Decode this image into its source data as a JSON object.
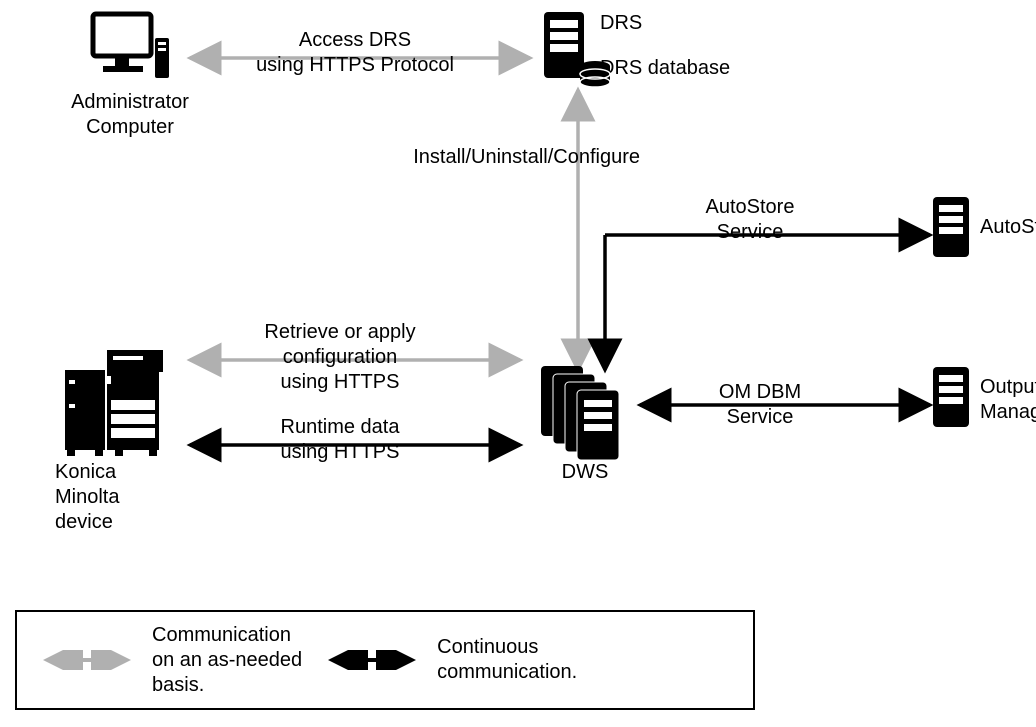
{
  "nodes": {
    "admin_computer": {
      "label1": "Administrator",
      "label2": "Computer"
    },
    "drs": {
      "label_top": "DRS",
      "label_db": "DRS database"
    },
    "dws": {
      "label": "DWS"
    },
    "konica": {
      "label1": "Konica",
      "label2": "Minolta",
      "label3": "device"
    },
    "autostore_service_label": "AutoStore\nService",
    "autostore": {
      "label": "AutoStore"
    },
    "om_dbm_service_label": "OM DBM\nService",
    "output_manager": {
      "label1": "Output",
      "label2": "Manager"
    }
  },
  "edges": {
    "access_drs": {
      "line1": "Access DRS",
      "line2": "using HTTPS Protocol"
    },
    "install_configure": "Install/Uninstall/Configure",
    "retrieve_apply": {
      "line1": "Retrieve or apply",
      "line2": "configuration",
      "line3": "using HTTPS"
    },
    "runtime": {
      "line1": "Runtime data",
      "line2": "using HTTPS"
    }
  },
  "legend": {
    "gray": {
      "line1": "Communication",
      "line2": "on an as-needed",
      "line3": "basis."
    },
    "black": {
      "line1": "Continuous",
      "line2": "communication."
    }
  },
  "colors": {
    "gray": "#b0b0b0",
    "black": "#000000"
  }
}
